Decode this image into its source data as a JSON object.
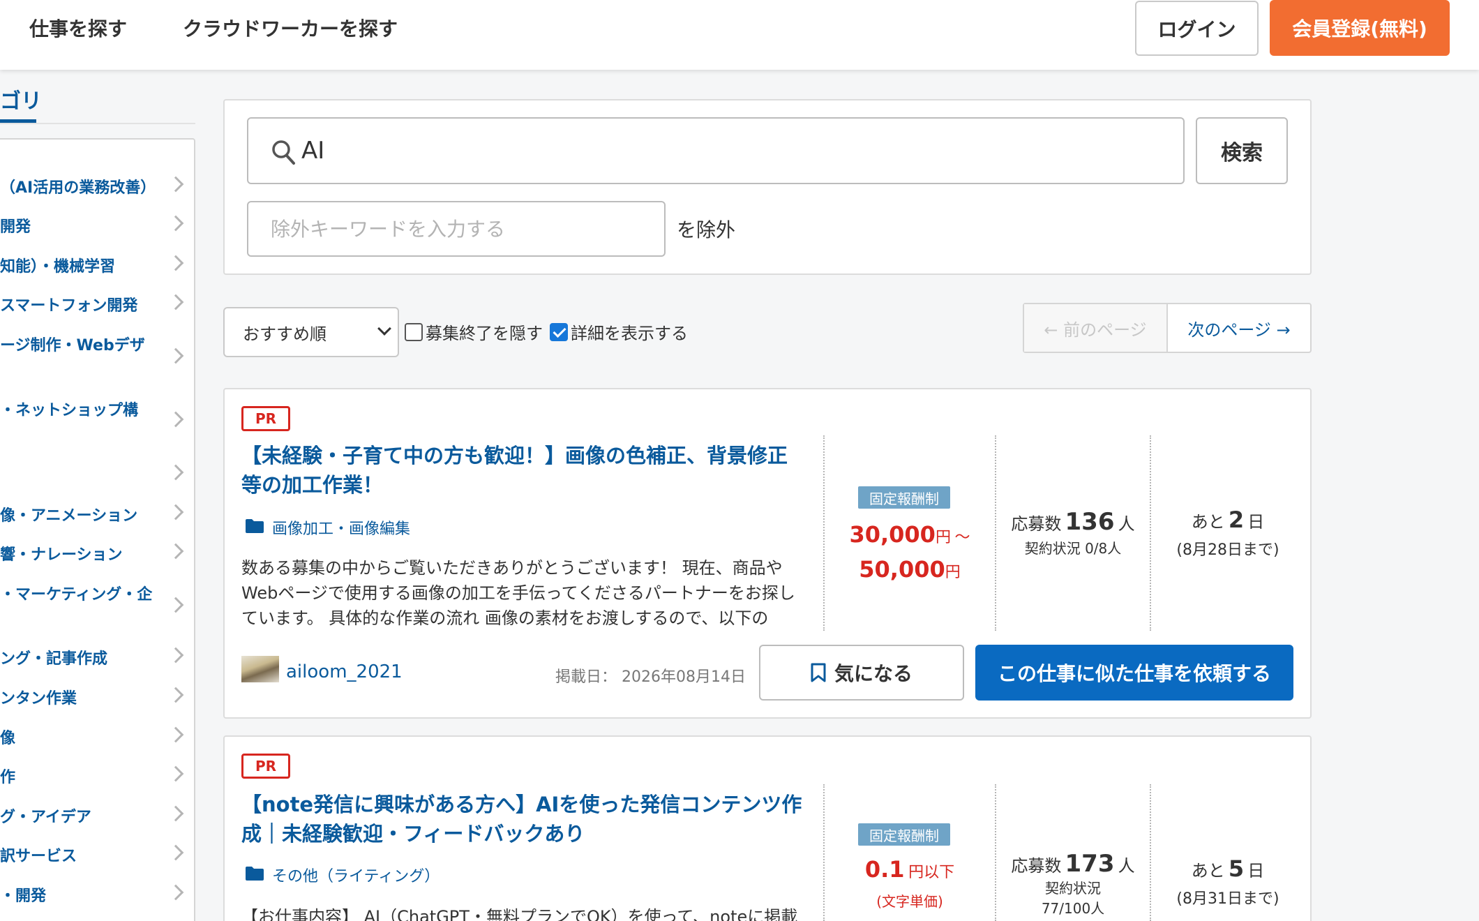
{
  "header": {
    "nav": [
      "仕事を探す",
      "クラウドワーカーを探す"
    ],
    "login_label": "ログイン",
    "register_label": "会員登録(無料)"
  },
  "sidebar": {
    "title": "ゴリ",
    "items": [
      "（AI活用の業務改善）",
      "開発",
      "知能）・機械学習",
      "スマートフォン開発",
      "ージ制作・Webデザ",
      "・ネットショップ構",
      "",
      "像・アニメーション",
      "響・ナレーション",
      "・マーケティング・企",
      "ング・記事作成",
      "ンタン作業",
      "像",
      "作",
      "グ・アイデア",
      "訳サービス",
      "・開発"
    ]
  },
  "search": {
    "value": "AI",
    "button_label": "検索",
    "exclude_placeholder": "除外キーワードを入力する",
    "exclude_suffix": "を除外"
  },
  "controls": {
    "sort_selected": "おすすめ順",
    "hide_closed_label": "募集終了を隠す",
    "hide_closed_checked": false,
    "show_details_label": "詳細を表示する",
    "show_details_checked": true,
    "prev_label": "← 前のページ",
    "next_label": "次のページ →"
  },
  "jobs": [
    {
      "pr": "PR",
      "title": "【未経験・子育て中の方も歓迎！】画像の色補正、背景修正等の加工作業！",
      "category": "画像加工・画像編集",
      "description": "数ある募集の中からご覧いただきありがとうございます！ 現在、商品やWebページで使用する画像の加工を手伝ってくださるパートナーをお探しています。 具体的な作業の流れ 画像の素材をお渡しするので、以下の作…",
      "pay_type": "固定報酬制",
      "price_min": "30,000",
      "price_max": "50,000",
      "currency": "円",
      "range_sep": "～",
      "applicants_label": "応募数",
      "applicants": "136",
      "unit_person": "人",
      "contract_label": "契約状況",
      "contract_value": "0/8人",
      "remaining_prefix": "あと",
      "remaining_days": "2",
      "remaining_unit": "日",
      "deadline": "(8月28日まで)",
      "user": "ailoom_2021",
      "posted_label": "掲載日：",
      "posted_date": "2026年08月14日",
      "fav_label": "気になる",
      "request_label": "この仕事に似た仕事を依頼する"
    },
    {
      "pr": "PR",
      "title": "【note発信に興味がある方へ】AIを使った発信コンテンツ作成｜未経験歓迎・フィードバックあり",
      "category": "その他（ライティング）",
      "description": "【お仕事内容】 AI（ChatGPT・無料プランでOK）を使って、noteに掲載",
      "pay_type": "固定報酬制",
      "price": "0.1",
      "price_suffix": "円以下",
      "price_note": "(文字単価)",
      "applicants_label": "応募数",
      "applicants": "173",
      "unit_person": "人",
      "contract_label": "契約状況",
      "contract_value": "77/100人",
      "remaining_prefix": "あと",
      "remaining_days": "5",
      "remaining_unit": "日",
      "deadline": "(8月31日まで)"
    }
  ],
  "colors": {
    "brand_blue": "#0a5a9c",
    "register_orange": "#f26d31",
    "price_red": "#d7261f",
    "badge_blue": "#6fa4c7"
  }
}
